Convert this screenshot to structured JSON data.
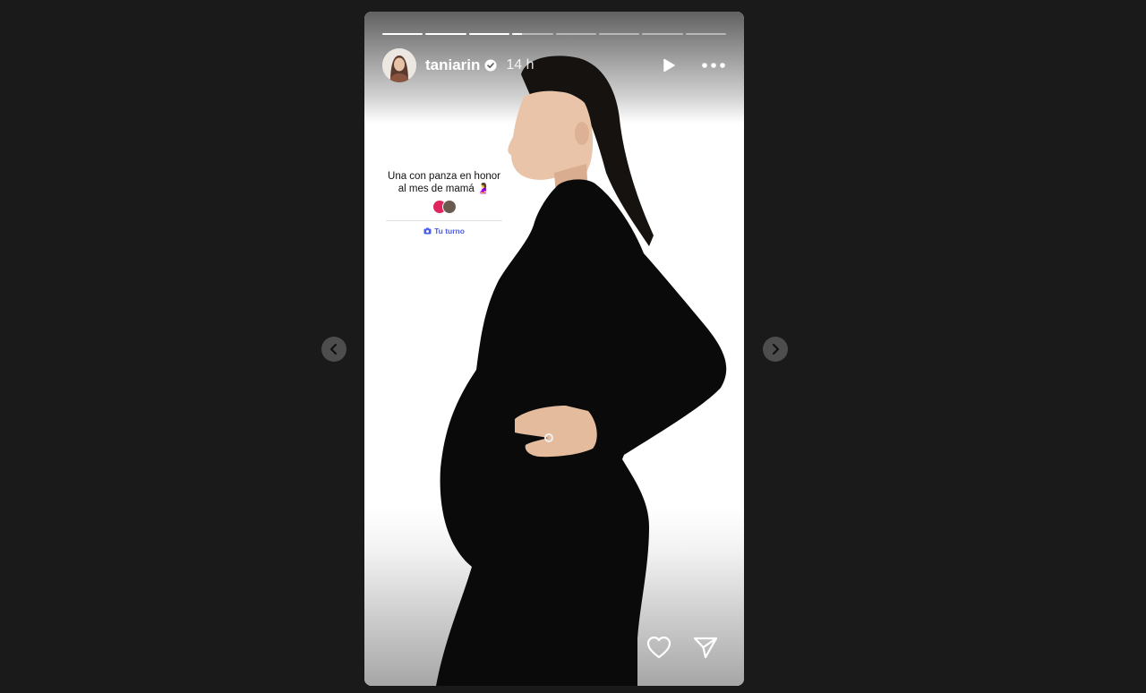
{
  "story": {
    "username": "taniarin",
    "time": "14 h",
    "segments_total": 8,
    "segments_progress": [
      1,
      1,
      1,
      0.25,
      0,
      0,
      0,
      0
    ]
  },
  "sticker": {
    "text": "Una con panza en honor al mes de mamá 🤰",
    "cta": "Tu turno"
  },
  "icons": {
    "verified": "verified-badge-icon",
    "play": "play-icon",
    "more": "more-options-icon",
    "like": "heart-icon",
    "share": "send-icon",
    "prev": "chevron-left-icon",
    "next": "chevron-right-icon",
    "camera": "camera-icon"
  },
  "colors": {
    "background": "#1a1a1a",
    "link": "#4a5ee8",
    "sticker_accent": "#e0245e"
  }
}
